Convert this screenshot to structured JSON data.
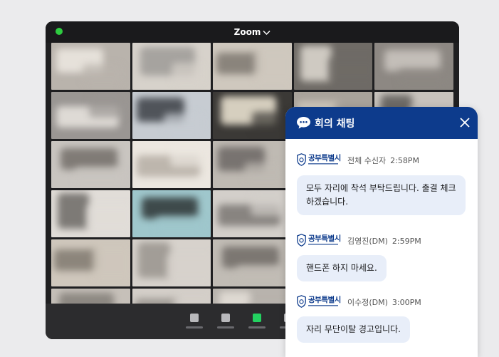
{
  "window": {
    "title": "Zoom",
    "status_dot_color": "#2ecc40"
  },
  "video_tiles": [
    {
      "c1": "#b9b3ac",
      "c2": "#e6e1da"
    },
    {
      "c1": "#d7d2cb",
      "c2": "#a6a39f"
    },
    {
      "c1": "#cfc8be",
      "c2": "#8a847c"
    },
    {
      "c1": "#6f6b66",
      "c2": "#cfcac2"
    },
    {
      "c1": "#8d8883",
      "c2": "#c3beb8"
    },
    {
      "c1": "#9a9693",
      "c2": "#dedad5"
    },
    {
      "c1": "#c7ccd2",
      "c2": "#50545a"
    },
    {
      "c1": "#3b3936",
      "c2": "#d6cfbf"
    },
    {
      "c1": "#a9a39b",
      "c2": "#d2cbbf"
    },
    {
      "c1": "#c8c3bd",
      "c2": "#6d6a66"
    },
    {
      "c1": "#c9c5c0",
      "c2": "#807b76"
    },
    {
      "c1": "#ece7e0",
      "c2": "#bdb6ad"
    },
    {
      "c1": "#bfbab3",
      "c2": "#787370"
    },
    {
      "c1": "#4a4846",
      "c2": "#d8d3cc"
    },
    {
      "c1": "#d3cec8",
      "c2": "#9b968f"
    },
    {
      "c1": "#e1ddd8",
      "c2": "#7d7a76"
    },
    {
      "c1": "#9fc7cc",
      "c2": "#3e4a4b"
    },
    {
      "c1": "#d3cfca",
      "c2": "#888480"
    },
    {
      "c1": "#bcb7b1",
      "c2": "#e2ddd6"
    },
    {
      "c1": "#5a5856",
      "c2": "#c9c4bd"
    },
    {
      "c1": "#cfc7bc",
      "c2": "#8c857b"
    },
    {
      "c1": "#d7d2cc",
      "c2": "#a29d97"
    },
    {
      "c1": "#c1bcb5",
      "c2": "#7c7772"
    },
    {
      "c1": "#e0dbd4",
      "c2": "#b1aca5"
    },
    {
      "c1": "#3e3c3a",
      "c2": "#a9a49e"
    },
    {
      "c1": "#c6c0b9",
      "c2": "#8d8882"
    },
    {
      "c1": "#d4cfc9",
      "c2": "#9e9993"
    },
    {
      "c1": "#b8b3ad",
      "c2": "#ded9d2"
    },
    {
      "c1": "#cac5be",
      "c2": "#6f6b67"
    },
    {
      "c1": "#4c4a48",
      "c2": "#bab5af"
    }
  ],
  "toolbar": {
    "buttons": [
      {
        "name": "mute-button",
        "color": "#b9b9bc"
      },
      {
        "name": "video-button",
        "color": "#b9b9bc"
      },
      {
        "name": "share-button",
        "color": "#23d160"
      },
      {
        "name": "chat-button",
        "color": "#b9b9bc"
      }
    ]
  },
  "chat": {
    "title": "회의 채팅",
    "brand_color": "#0d3b8c",
    "logo_text": "공부특별시",
    "messages": [
      {
        "sender": "전체 수신자",
        "time": "2:58PM",
        "text_lines": [
          "모두 자리에 착석 부탁드립니다. 출결 체크",
          "하겠습니다."
        ]
      },
      {
        "sender": "김영진(DM)",
        "time": "2:59PM",
        "text_lines": [
          "핸드폰 하지 마세요."
        ]
      },
      {
        "sender": "이수정(DM)",
        "time": "3:00PM",
        "text_lines": [
          "자리 무단이탈 경고입니다."
        ]
      }
    ]
  }
}
